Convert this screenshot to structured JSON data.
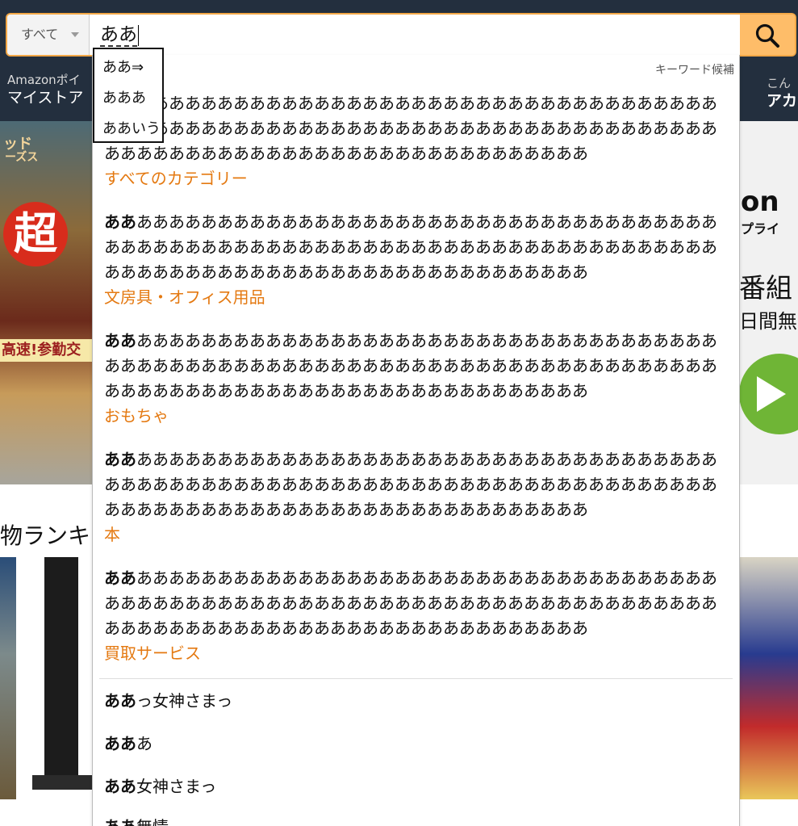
{
  "search": {
    "category": "すべて",
    "query": "ああ",
    "submit_icon": "search-icon"
  },
  "nav": {
    "left_line1": "Amazonポイ",
    "left_line2": "マイストア",
    "right_line1": "こん",
    "right_line2": "アカ"
  },
  "background": {
    "hero_left_title1": "ッド",
    "hero_left_title2": "ーズス",
    "hero_left_sign": "超",
    "hero_left_band": "高速!参勤交",
    "hero_right_logo": "on",
    "hero_right_sub": "プライ",
    "hero_right_line1": "番組",
    "hero_right_line2": "日間無",
    "ranking_title": "物ランキン"
  },
  "suggestions": {
    "keyword_label": "キーワード候補",
    "long_items": [
      {
        "prefix": "ああ",
        "rest": "ああああああああああああああああああああああああああああああああああああああああああああああああああああああああああああああああああああああああああああああああああああああああああああああああああああああああ",
        "category": "すべてのカテゴリー"
      },
      {
        "prefix": "ああ",
        "rest": "ああああああああああああああああああああああああああああああああああああああああああああああああああああああああああああああああああああああああああああああああああああああああああああああああああああああああ",
        "category": "文房具・オフィス用品"
      },
      {
        "prefix": "ああ",
        "rest": "ああああああああああああああああああああああああああああああああああああああああああああああああああああああああああああああああああああああああああああああああああああああああああああああああああああああああ",
        "category": "おもちゃ"
      },
      {
        "prefix": "ああ",
        "rest": "ああああああああああああああああああああああああああああああああああああああああああああああああああああああああああああああああああああああああああああああああああああああああああああああああああああああああ",
        "category": "本"
      },
      {
        "prefix": "ああ",
        "rest": "ああああああああああああああああああああああああああああああああああああああああああああああああああああああああああああああああああああああああああああああああああああああああああああああああああああああああ",
        "category": "買取サービス"
      }
    ],
    "short_items": [
      {
        "prefix": "ああ",
        "rest": "っ女神さまっ"
      },
      {
        "prefix": "ああ",
        "rest": "あ"
      },
      {
        "prefix": "ああ",
        "rest": "女神さまっ"
      },
      {
        "prefix": "ああ",
        "rest": "無情"
      }
    ]
  },
  "ime_candidates": [
    "ああ⇒",
    "あああ",
    "ああいう"
  ],
  "colors": {
    "nav_bg": "#232f3e",
    "search_button": "#febd69",
    "category_link": "#e47911"
  }
}
